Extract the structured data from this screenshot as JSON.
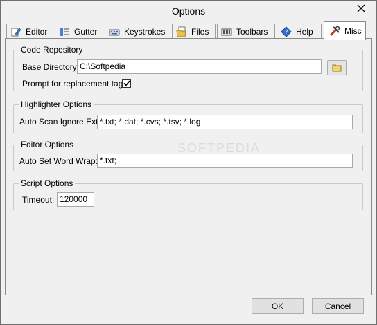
{
  "window": {
    "title": "Options"
  },
  "tabs": [
    {
      "label": "Editor",
      "icon": "pencil-icon"
    },
    {
      "label": "Gutter",
      "icon": "gutter-icon"
    },
    {
      "label": "Keystrokes",
      "icon": "keyboard-icon"
    },
    {
      "label": "Files",
      "icon": "files-icon"
    },
    {
      "label": "Toolbars",
      "icon": "toolbar-icon"
    },
    {
      "label": "Help",
      "icon": "help-icon"
    },
    {
      "label": "Misc",
      "icon": "tools-icon",
      "active": true
    }
  ],
  "code_repository": {
    "caption": "Code Repository",
    "base_directory_label": "Base Directory:",
    "base_directory_value": "C:\\Softpedia",
    "prompt_label": "Prompt for replacement tags:",
    "prompt_checked": true
  },
  "highlighter_options": {
    "caption": "Highlighter Options",
    "auto_scan_label": "Auto Scan Ignore Ext:",
    "auto_scan_value": "*.txt; *.dat; *.cvs; *.tsv; *.log"
  },
  "editor_options": {
    "caption": "Editor Options",
    "word_wrap_label": "Auto Set Word Wrap:",
    "word_wrap_value": "*.txt;"
  },
  "script_options": {
    "caption": "Script Options",
    "timeout_label": "Timeout:",
    "timeout_value": "120000"
  },
  "footer": {
    "ok_label": "OK",
    "cancel_label": "Cancel"
  },
  "watermark": "SOFTPEDIA"
}
